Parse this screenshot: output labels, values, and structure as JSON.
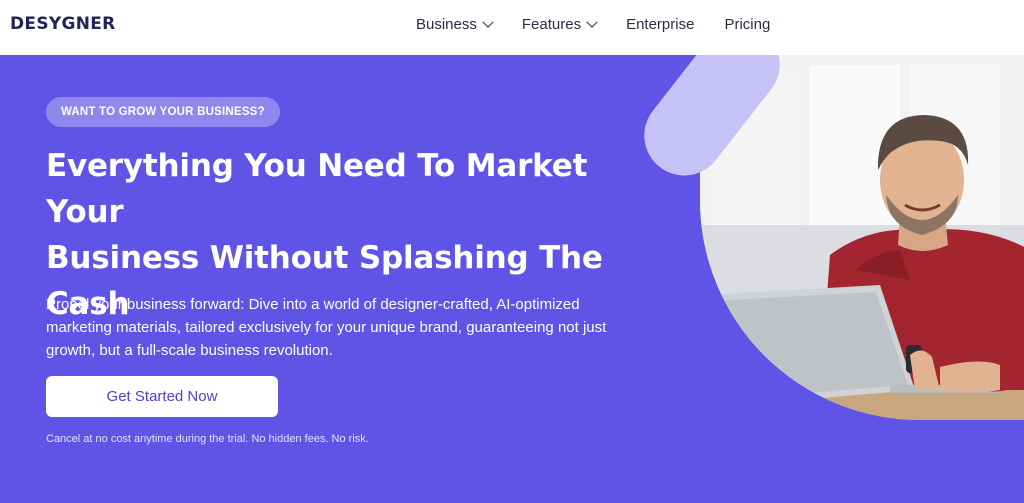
{
  "brand": {
    "logo": "DESYGNER"
  },
  "nav": {
    "items": [
      {
        "label": "Business",
        "has_dropdown": true
      },
      {
        "label": "Features",
        "has_dropdown": true
      },
      {
        "label": "Enterprise",
        "has_dropdown": false
      },
      {
        "label": "Pricing",
        "has_dropdown": false
      }
    ]
  },
  "hero": {
    "badge": "WANT TO GROW YOUR BUSINESS?",
    "headline_line1": "Everything You Need To Market Your",
    "headline_line2": "Business Without Splashing The",
    "headline_line3": "Cash",
    "description": "Propel your business forward: Dive into a world of designer-crafted, AI-optimized marketing materials, tailored exclusively for your unique brand, guaranteeing not just growth, but a full-scale business revolution.",
    "cta_label": "Get Started Now",
    "fine_print": "Cancel at no cost anytime during the trial. No hidden fees. No risk."
  },
  "colors": {
    "hero_bg": "#6054e6",
    "badge_bg": "#8f86ee",
    "accent_pill": "#c6c1f6",
    "cta_text": "#4c44c9",
    "logo": "#1f2557"
  },
  "image": {
    "subject": "smiling man in red shirt using a laptop"
  }
}
